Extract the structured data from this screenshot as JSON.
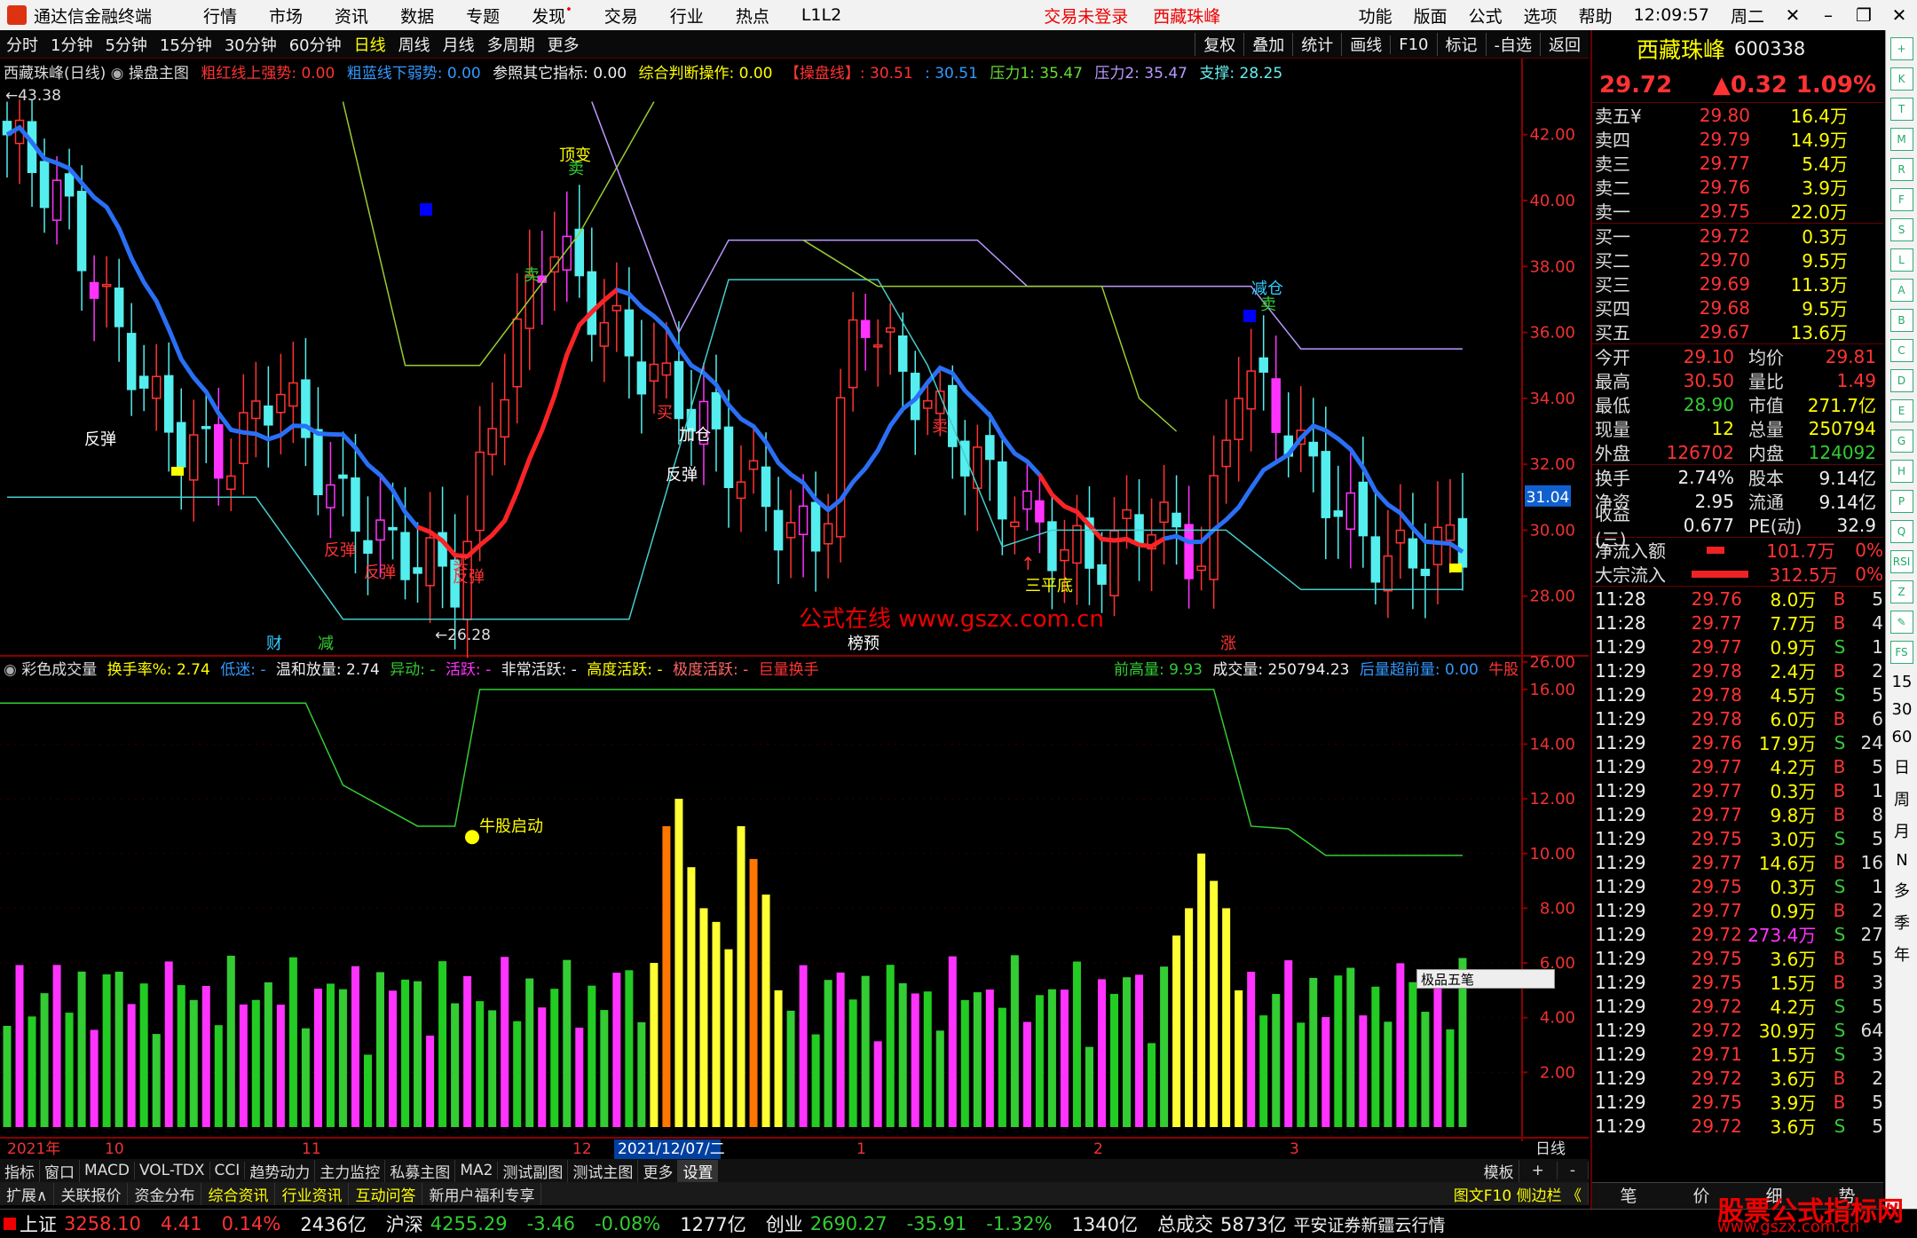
{
  "menu": {
    "app_title": "通达信金融终端",
    "items": [
      "行情",
      "市场",
      "资讯",
      "数据",
      "专题",
      "发现",
      "交易",
      "行业",
      "热点",
      "L1L2"
    ],
    "login": "交易未登录",
    "stock": "西藏珠峰",
    "right": [
      "功能",
      "版面",
      "公式",
      "选项",
      "帮助"
    ],
    "time": "12:09:57",
    "weekday": "周二"
  },
  "periods": [
    "分时",
    "1分钟",
    "5分钟",
    "15分钟",
    "30分钟",
    "60分钟",
    "日线",
    "周线",
    "月线",
    "多周期",
    "更多"
  ],
  "period_active": "日线",
  "toolbar_right": [
    "复权",
    "叠加",
    "统计",
    "画线",
    "F10",
    "标记",
    "-自选",
    "返回"
  ],
  "main_ind": {
    "title": "西藏珠峰(日线)",
    "name": "操盘主图",
    "a": "粗红线上强势: 0.00",
    "b": "粗蓝线下弱势: 0.00",
    "c": "参照其它指标: 0.00",
    "d": "综合判断操作: 0.00",
    "e": "【操盘线】: 30.51",
    "f": ": 30.51",
    "g": "压力1: 35.47",
    "h": "压力2: 35.47",
    "i": "支撑: 28.25"
  },
  "sub_ind": {
    "name": "彩色成交量",
    "a": "换手率%: 2.74",
    "b": "低迷: -",
    "c": "温和放量: 2.74",
    "d": "异动: -",
    "e": "活跃: -",
    "f": "非常活跃: -",
    "g": "高度活跃: -",
    "h": "极度活跃: -",
    "i": "巨量换手",
    "j": "前高量: 9.93",
    "k": "成交量: 250794.23",
    "l": "后量超前量: 0.00",
    "m": "牛股"
  },
  "chart_data": [
    {
      "type": "candlestick",
      "title": "西藏珠峰(日线)",
      "x_range": [
        "2021年10",
        "3"
      ],
      "ylim": [
        26,
        43.5
      ],
      "yticks": [
        26.0,
        28.0,
        30.0,
        32.0,
        34.0,
        36.0,
        38.0,
        40.0,
        42.0
      ],
      "max_label": "43.38",
      "min_label": "26.28",
      "price_tag": "31.04",
      "annotations": [
        "反弹",
        "反弹",
        "反弹",
        "反弹",
        "反弹",
        "加仓",
        "顶变",
        "卖",
        "卖",
        "买",
        "买",
        "卖",
        "减仓",
        "卖",
        "三平底",
        "财",
        "减",
        "榜预",
        "涨"
      ],
      "watermark": "公式在线  www.gszx.com.cn"
    },
    {
      "type": "bar",
      "title": "彩色成交量",
      "ylim": [
        0,
        17
      ],
      "yticks": [
        2.0,
        4.0,
        6.0,
        8.0,
        10.0,
        12.0,
        14.0,
        16.0
      ],
      "annotation": "牛股启动"
    }
  ],
  "xaxis": {
    "labels": [
      "2021年",
      "10",
      "11",
      "12",
      "2021/12/07/二",
      "1",
      "2",
      "3"
    ],
    "right": "日线"
  },
  "bottom_tabs": [
    "指标",
    "窗口",
    "MACD",
    "VOL-TDX",
    "CCI",
    "趋势动力",
    "主力监控",
    "私募主图",
    "MA2",
    "测试副图",
    "测试主图",
    "更多",
    "设置"
  ],
  "bottom_tabs_right": [
    "模板",
    "+",
    "-"
  ],
  "bottom_tabs2": [
    "扩展∧",
    "关联报价",
    "资金分布",
    "综合资讯",
    "行业资讯",
    "互动问答",
    "新用户福利专享"
  ],
  "status": {
    "sh": "上证",
    "sh_v": "3258.10",
    "sh_c": "4.41",
    "sh_p": "0.14%",
    "sh_a": "2436亿",
    "hs": "沪深",
    "hs_v": "4255.29",
    "hs_c": "-3.46",
    "hs_p": "-0.08%",
    "hs_a": "1277亿",
    "cy": "创业",
    "cy_v": "2690.27",
    "cy_c": "-35.91",
    "cy_p": "-1.32%",
    "cy_a": "1340亿",
    "tot": "总成交",
    "tot_v": "5873亿",
    "srv": "平安证券新疆云行情"
  },
  "rp": {
    "name": "西藏珠峰",
    "code": "600338",
    "price": "29.72",
    "chg": "▲0.32",
    "pct": "1.09%",
    "asks": [
      [
        "卖五¥",
        "29.80",
        "16.4万"
      ],
      [
        "卖四",
        "29.79",
        "14.9万"
      ],
      [
        "卖三",
        "29.77",
        "5.4万"
      ],
      [
        "卖二",
        "29.76",
        "3.9万"
      ],
      [
        "卖一",
        "29.75",
        "22.0万"
      ]
    ],
    "bids": [
      [
        "买一",
        "29.72",
        "0.3万"
      ],
      [
        "买二",
        "29.70",
        "9.5万"
      ],
      [
        "买三",
        "29.69",
        "11.3万"
      ],
      [
        "买四",
        "29.68",
        "9.5万"
      ],
      [
        "买五",
        "29.67",
        "13.6万"
      ]
    ],
    "stats": [
      [
        "今开",
        "29.10",
        "均价",
        "29.81"
      ],
      [
        "最高",
        "30.50",
        "量比",
        "1.49"
      ],
      [
        "最低",
        "28.90",
        "市值",
        "271.7亿"
      ],
      [
        "现量",
        "12",
        "总量",
        "250794"
      ],
      [
        "外盘",
        "126702",
        "内盘",
        "124092"
      ]
    ],
    "stats2": [
      [
        "换手",
        "2.74%",
        "股本",
        "9.14亿"
      ],
      [
        "净资",
        "2.95",
        "流通",
        "9.14亿"
      ],
      [
        "收益(三)",
        "0.677",
        "PE(动)",
        "32.9"
      ]
    ],
    "flow": [
      [
        "净流入额",
        "101.7万",
        "0%"
      ],
      [
        "大宗流入",
        "312.5万",
        "0%"
      ]
    ],
    "ticks": [
      [
        "11:28",
        "29.76",
        "8.0万",
        "B",
        "5"
      ],
      [
        "11:28",
        "29.77",
        "7.7万",
        "B",
        "4"
      ],
      [
        "11:29",
        "29.77",
        "0.9万",
        "S",
        "1"
      ],
      [
        "11:29",
        "29.78",
        "2.4万",
        "B",
        "2"
      ],
      [
        "11:29",
        "29.78",
        "4.5万",
        "S",
        "5"
      ],
      [
        "11:29",
        "29.78",
        "6.0万",
        "B",
        "6"
      ],
      [
        "11:29",
        "29.76",
        "17.9万",
        "S",
        "24"
      ],
      [
        "11:29",
        "29.77",
        "4.2万",
        "B",
        "5"
      ],
      [
        "11:29",
        "29.77",
        "0.3万",
        "B",
        "1"
      ],
      [
        "11:29",
        "29.77",
        "9.8万",
        "B",
        "8"
      ],
      [
        "11:29",
        "29.75",
        "3.0万",
        "S",
        "5"
      ],
      [
        "11:29",
        "29.77",
        "14.6万",
        "B",
        "16"
      ],
      [
        "11:29",
        "29.75",
        "0.3万",
        "S",
        "1"
      ],
      [
        "11:29",
        "29.77",
        "0.9万",
        "B",
        "2"
      ],
      [
        "11:29",
        "29.72",
        "273.4万",
        "S",
        "27"
      ],
      [
        "11:29",
        "29.75",
        "3.6万",
        "B",
        "5"
      ],
      [
        "11:29",
        "29.75",
        "1.5万",
        "B",
        "3"
      ],
      [
        "11:29",
        "29.72",
        "4.2万",
        "S",
        "5"
      ],
      [
        "11:29",
        "29.72",
        "30.9万",
        "S",
        "64"
      ],
      [
        "11:29",
        "29.71",
        "1.5万",
        "S",
        "3"
      ],
      [
        "11:29",
        "29.72",
        "3.6万",
        "B",
        "2"
      ],
      [
        "11:29",
        "29.75",
        "3.9万",
        "B",
        "5"
      ],
      [
        "11:29",
        "29.72",
        "3.6万",
        "S",
        "5"
      ]
    ],
    "foot": [
      "笔",
      "价",
      "细",
      "势"
    ]
  },
  "ime": "极品五笔",
  "side_labels": [
    "15",
    "30",
    "60",
    "日",
    "周",
    "月",
    "N",
    "多",
    "季",
    "年"
  ],
  "side_icons": [
    "+",
    "K",
    "T",
    "M",
    "R",
    "F",
    "S",
    "L",
    "A",
    "B",
    "C",
    "D",
    "E",
    "G",
    "H",
    "P",
    "Q",
    "RSI",
    "Z",
    "✎",
    "FS"
  ],
  "footer_link": "图文F10  侧边栏 《",
  "brand": {
    "name": "股票公式指标网",
    "url": "www.gszx.com.cn"
  }
}
